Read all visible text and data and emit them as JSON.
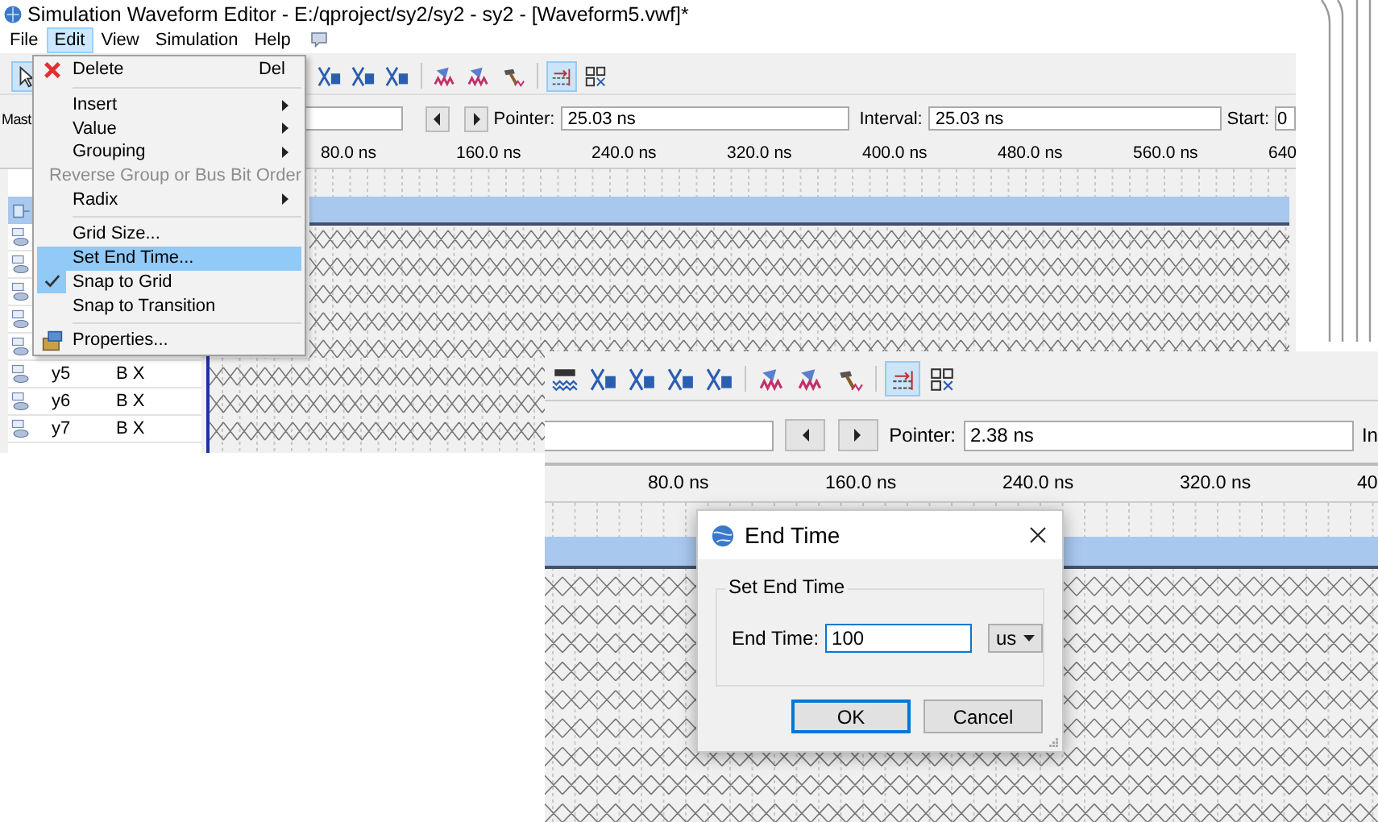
{
  "editor_window": {
    "title": "Simulation Waveform Editor - E:/qproject/sy2/sy2 - sy2 - [Waveform5.vwf]*",
    "menu_bar": [
      {
        "label": "File",
        "selected": false
      },
      {
        "label": "Edit",
        "selected": true
      },
      {
        "label": "View",
        "selected": false
      },
      {
        "label": "Simulation",
        "selected": false
      },
      {
        "label": "Help",
        "selected": false
      }
    ],
    "toolbar": [
      {
        "kind": "pointer",
        "active": true
      },
      {
        "kind": "x-symbol",
        "active": false
      },
      {
        "kind": "x-symbol",
        "active": false
      },
      {
        "kind": "x-symbol",
        "active": false
      },
      {
        "kind": "separator"
      },
      {
        "kind": "waveform",
        "active": false
      },
      {
        "kind": "waveform",
        "active": false
      },
      {
        "kind": "hammer",
        "active": false
      },
      {
        "kind": "separator"
      },
      {
        "kind": "snap-grid",
        "active": true
      },
      {
        "kind": "squares",
        "active": false
      }
    ],
    "time_bar": {
      "master_label": "Mast",
      "pointer_label": "Pointer:",
      "pointer_value": "25.03 ns",
      "interval_label": "Interval:",
      "interval_value": "25.03 ns",
      "start_label": "Start:",
      "start_value": "0"
    },
    "ruler": [
      "80.0 ns",
      "160.0 ns",
      "240.0 ns",
      "320.0 ns",
      "400.0 ns",
      "480.0 ns",
      "560.0 ns",
      "640"
    ],
    "signal_rows": [
      {
        "kind": "covered"
      },
      {
        "kind": "covered"
      },
      {
        "kind": "covered"
      },
      {
        "kind": "covered"
      },
      {
        "kind": "covered"
      },
      {
        "kind": "signal",
        "name": "y5",
        "value": "B X"
      },
      {
        "kind": "signal",
        "name": "y6",
        "value": "B X"
      },
      {
        "kind": "signal",
        "name": "y7",
        "value": "B X"
      }
    ]
  },
  "edit_menu": {
    "items": [
      {
        "kind": "delete",
        "label": "Delete",
        "shortcut": "Del",
        "submenu": false,
        "disabled": false,
        "checked": false,
        "selected": false
      },
      {
        "kind": "separator"
      },
      {
        "kind": "item",
        "label": "Insert",
        "submenu": true,
        "disabled": false,
        "checked": false,
        "selected": false
      },
      {
        "kind": "item",
        "label": "Value",
        "submenu": true,
        "disabled": false,
        "checked": false,
        "selected": false
      },
      {
        "kind": "item",
        "label": "Grouping",
        "submenu": true,
        "disabled": false,
        "checked": false,
        "selected": false
      },
      {
        "kind": "item",
        "label": "Reverse Group or Bus Bit Order",
        "submenu": false,
        "disabled": true,
        "checked": false,
        "selected": false
      },
      {
        "kind": "item",
        "label": "Radix",
        "submenu": true,
        "disabled": false,
        "checked": false,
        "selected": false
      },
      {
        "kind": "separator"
      },
      {
        "kind": "item",
        "label": "Grid Size...",
        "submenu": false,
        "disabled": false,
        "checked": false,
        "selected": false
      },
      {
        "kind": "item",
        "label": "Set End Time...",
        "submenu": false,
        "disabled": false,
        "checked": false,
        "selected": true
      },
      {
        "kind": "item",
        "label": "Snap to Grid",
        "submenu": false,
        "disabled": false,
        "checked": true,
        "selected": false
      },
      {
        "kind": "item",
        "label": "Snap to Transition",
        "submenu": false,
        "disabled": false,
        "checked": false,
        "selected": false
      },
      {
        "kind": "separator"
      },
      {
        "kind": "properties",
        "label": "Properties...",
        "submenu": false,
        "disabled": false,
        "checked": false,
        "selected": false
      }
    ]
  },
  "second_window": {
    "toolbar": [
      {
        "kind": "wave-lines",
        "active": false
      },
      {
        "kind": "x-symbol",
        "active": false
      },
      {
        "kind": "x-symbol",
        "active": false
      },
      {
        "kind": "x-symbol",
        "active": false
      },
      {
        "kind": "x-symbol",
        "active": false
      },
      {
        "kind": "separator"
      },
      {
        "kind": "waveform",
        "active": false
      },
      {
        "kind": "waveform",
        "active": false
      },
      {
        "kind": "hammer",
        "active": false
      },
      {
        "kind": "separator"
      },
      {
        "kind": "snap-grid",
        "active": true
      },
      {
        "kind": "squares",
        "active": false
      }
    ],
    "pointer_label": "Pointer:",
    "pointer_value": "2.38 ns",
    "interval_label": "In",
    "ruler": [
      "80.0 ns",
      "160.0 ns",
      "240.0 ns",
      "320.0 ns",
      "40"
    ]
  },
  "end_time_dialog": {
    "title": "End Time",
    "group_title": "Set End Time",
    "field_label": "End Time:",
    "field_value": "100",
    "unit": "us",
    "buttons": [
      {
        "label": "OK",
        "focused": true
      },
      {
        "label": "Cancel",
        "focused": false
      }
    ]
  }
}
